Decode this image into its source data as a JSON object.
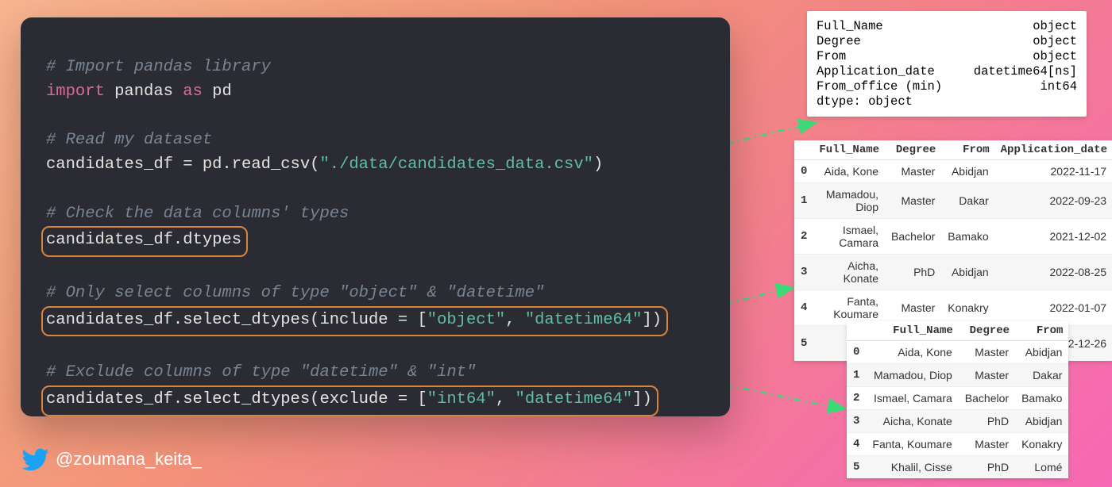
{
  "code": {
    "c1": "# Import pandas library",
    "l1a": "import",
    "l1b": "pandas",
    "l1c": "as",
    "l1d": "pd",
    "c2": "# Read my dataset",
    "l2a": "candidates_df = pd.read_csv(",
    "l2b": "\"./data/candidates_data.csv\"",
    "l2c": ")",
    "c3": "# Check the data columns' types",
    "l3": "candidates_df.dtypes",
    "c4": "# Only select columns of type \"object\" & \"datetime\"",
    "l4a": "candidates_df.select_dtypes(include = [",
    "l4b": "\"object\"",
    "l4c": ", ",
    "l4d": "\"datetime64\"",
    "l4e": "])",
    "c5": "# Exclude columns of type \"datetime\" & \"int\"",
    "l5a": "candidates_df.select_dtypes(exclude = [",
    "l5b": "\"int64\"",
    "l5c": ", ",
    "l5d": "\"datetime64\"",
    "l5e": "])"
  },
  "handle": "@zoumana_keita_",
  "dtypes": {
    "rows": [
      {
        "col": "Full_Name",
        "type": "object"
      },
      {
        "col": "Degree",
        "type": "object"
      },
      {
        "col": "From",
        "type": "object"
      },
      {
        "col": "Application_date",
        "type": "datetime64[ns]"
      },
      {
        "col": "From_office (min)",
        "type": "int64"
      }
    ],
    "footer": "dtype: object"
  },
  "table1": {
    "headers": [
      "",
      "Full_Name",
      "Degree",
      "From",
      "Application_date"
    ],
    "rows": [
      [
        "0",
        "Aida, Kone",
        "Master",
        "Abidjan",
        "2022-11-17"
      ],
      [
        "1",
        "Mamadou, Diop",
        "Master",
        "Dakar",
        "2022-09-23"
      ],
      [
        "2",
        "Ismael, Camara",
        "Bachelor",
        "Bamako",
        "2021-12-02"
      ],
      [
        "3",
        "Aicha, Konate",
        "PhD",
        "Abidjan",
        "2022-08-25"
      ],
      [
        "4",
        "Fanta, Koumare",
        "Master",
        "Konakry",
        "2022-01-07"
      ],
      [
        "5",
        "Khalil, Cisse",
        "PhD",
        "Lomé",
        "2022-12-26"
      ]
    ]
  },
  "table2": {
    "headers": [
      "",
      "Full_Name",
      "Degree",
      "From"
    ],
    "rows": [
      [
        "0",
        "Aida, Kone",
        "Master",
        "Abidjan"
      ],
      [
        "1",
        "Mamadou, Diop",
        "Master",
        "Dakar"
      ],
      [
        "2",
        "Ismael, Camara",
        "Bachelor",
        "Bamako"
      ],
      [
        "3",
        "Aicha, Konate",
        "PhD",
        "Abidjan"
      ],
      [
        "4",
        "Fanta, Koumare",
        "Master",
        "Konakry"
      ],
      [
        "5",
        "Khalil, Cisse",
        "PhD",
        "Lomé"
      ]
    ]
  }
}
